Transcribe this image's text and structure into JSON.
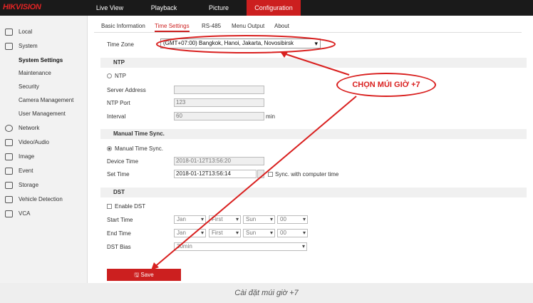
{
  "topbar": {
    "logo": "HIKVISION",
    "nav": [
      "Live View",
      "Playback",
      "Picture",
      "Configuration"
    ],
    "active_nav": "Configuration"
  },
  "sidebar": {
    "items": [
      "Local",
      "System",
      "System Settings",
      "Maintenance",
      "Security",
      "Camera Management",
      "User Management",
      "Network",
      "Video/Audio",
      "Image",
      "Event",
      "Storage",
      "Vehicle Detection",
      "VCA"
    ]
  },
  "tabs": [
    "Basic Information",
    "Time Settings",
    "RS-485",
    "Menu Output",
    "About"
  ],
  "time_zone": {
    "label": "Time Zone",
    "value": "(GMT+07:00) Bangkok, Hanoi, Jakarta, Novosibirsk"
  },
  "ntp": {
    "section": "NTP",
    "radio_label": "NTP",
    "server_label": "Server Address",
    "server_value": "",
    "port_label": "NTP Port",
    "port_value": "123",
    "interval_label": "Interval",
    "interval_value": "60",
    "interval_unit": "min"
  },
  "manual": {
    "section": "Manual Time Sync.",
    "radio_label": "Manual Time Sync.",
    "device_time_label": "Device Time",
    "device_time_value": "2018-01-12T13:56:20",
    "set_time_label": "Set Time",
    "set_time_value": "2018-01-12T13:56:14",
    "sync_label": "Sync. with computer time"
  },
  "dst": {
    "section": "DST",
    "enable_label": "Enable DST",
    "start_label": "Start Time",
    "end_label": "End Time",
    "bias_label": "DST Bias",
    "month": "Jan",
    "week": "First",
    "day": "Sun",
    "hour": "00",
    "bias_value": "30min"
  },
  "save_label": "Save",
  "annotation": "CHỌN MÚI GIỜ +7",
  "caption": "Cài đặt múi giờ +7",
  "colors": {
    "accent": "#cc1f1f",
    "annotation": "#d9201f"
  }
}
